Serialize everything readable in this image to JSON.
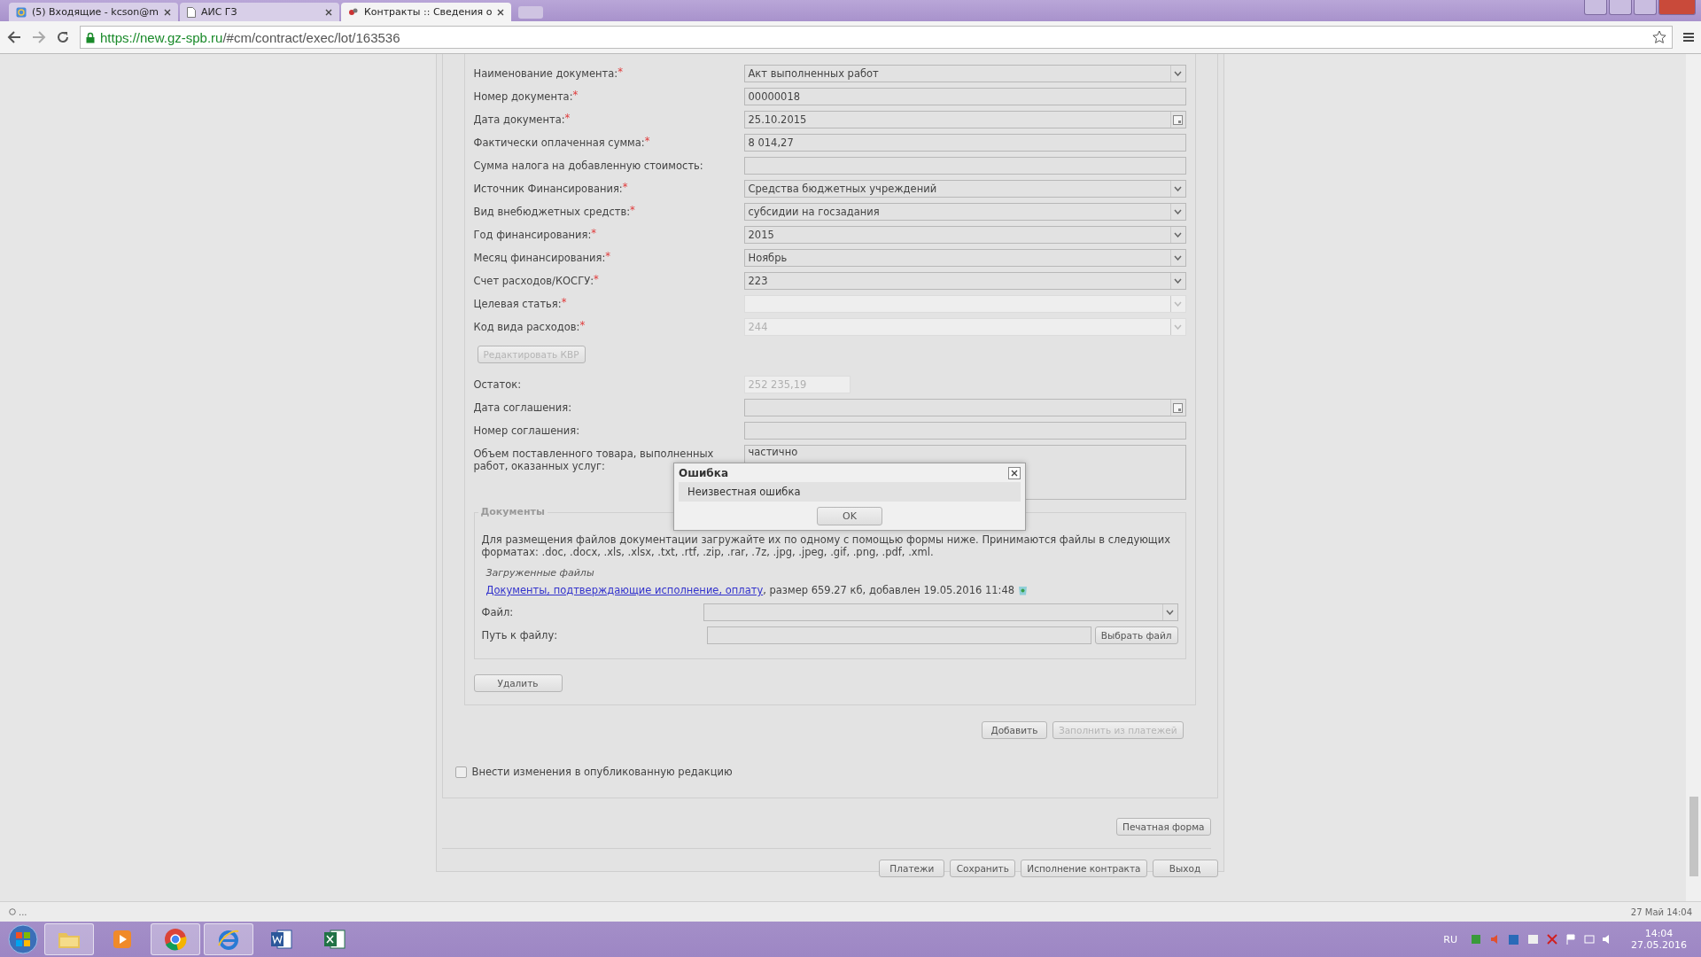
{
  "browser": {
    "tabs": [
      {
        "title": "(5) Входящие - kcson@m",
        "kind": "mail",
        "selected": false
      },
      {
        "title": "АИС ГЗ",
        "kind": "page",
        "selected": false
      },
      {
        "title": "Контракты :: Сведения о",
        "kind": "app",
        "selected": true
      }
    ],
    "url": {
      "host": "https://new.gz-spb.ru",
      "path": "/#cm/contract/exec/lot/163536"
    }
  },
  "form": {
    "fields": [
      {
        "label": "Наименование документа:",
        "required_mark": "*",
        "kind": "select",
        "value": "Акт выполненных работ",
        "disabled": false
      },
      {
        "label": "Номер документа:",
        "required_mark": "*",
        "kind": "text",
        "value": "00000018",
        "disabled": false
      },
      {
        "label": "Дата документа:",
        "required_mark": "*",
        "kind": "date",
        "value": "25.10.2015",
        "disabled": false
      },
      {
        "label": "Фактически оплаченная сумма:",
        "required_mark": "*",
        "kind": "text",
        "value": "8 014,27",
        "disabled": false
      },
      {
        "label": "Сумма налога на добавленную стоимость:",
        "kind": "text",
        "disabled": false
      },
      {
        "label": "Источник Финансирования:",
        "required_mark": "*",
        "kind": "select",
        "value": "Средства бюджетных учреждений",
        "disabled": false
      },
      {
        "label": "Вид внебюджетных средств:",
        "required_mark": "*",
        "kind": "select",
        "value": "субсидии на госзадания",
        "disabled": false
      },
      {
        "label": "Год финансирования:",
        "required_mark": "*",
        "kind": "select",
        "value": "2015",
        "disabled": false
      },
      {
        "label": "Месяц финансирования:",
        "required_mark": "*",
        "kind": "select",
        "value": "Ноябрь",
        "disabled": false
      },
      {
        "label": "Счет расходов/КОСГУ:",
        "required_mark": "*",
        "kind": "select",
        "value": "223",
        "disabled": false
      },
      {
        "label": "Целевая статья:",
        "required_mark": "*",
        "kind": "select",
        "disabled": true
      },
      {
        "label": "Код вида расходов:",
        "required_mark": "*",
        "kind": "select",
        "value": "244",
        "disabled": true
      }
    ],
    "edit_kvr_button": {
      "label": "Редактировать КВР",
      "disabled": true
    },
    "more_fields": [
      {
        "label": "Остаток:",
        "kind": "short",
        "value": "252 235,19",
        "disabled": true
      },
      {
        "label": "Дата соглашения:",
        "kind": "date",
        "disabled": false
      },
      {
        "label": "Номер соглашения:",
        "kind": "text",
        "disabled": false
      },
      {
        "label": "Объем поставленного товара, выполненных работ, оказанных услуг:",
        "kind": "textarea",
        "value": "частично",
        "disabled": false
      }
    ],
    "documents": {
      "legend": "Документы",
      "note": "Для размещения файлов документации загружайте их по одному с помощью формы ниже. Принимаются файлы в следующих форматах: .doc, .docx, .xls, .xlsx, .txt, .rtf, .zip, .rar, .7z, .jpg, .jpeg, .gif, .png, .pdf, .xml.",
      "uploaded_label": "Загруженные файлы",
      "files": [
        {
          "link": "Документы, подтверждающие исполнение, оплату",
          "info": ", размер 659.27 кб, добавлен 19.05.2016 11:48"
        }
      ],
      "file_label": "Файл:",
      "path_label": "Путь к файлу:",
      "browse_button": "Выбрать файл"
    },
    "delete_button": "Удалить",
    "actions": [
      {
        "label": "Добавить",
        "disabled": false
      },
      {
        "label": "Заполнить из платежей",
        "disabled": true
      }
    ],
    "publish_checkbox": {
      "label": "Внести изменения в опубликованную редакцию",
      "checked": false
    },
    "print_button": "Печатная форма",
    "footer_buttons": [
      "Платежи",
      "Сохранить",
      "Исполнение контракта",
      "Выход"
    ]
  },
  "dialog": {
    "title": "Ошибка",
    "message": "Неизвестная ошибка",
    "button": "OK"
  },
  "status_bar": {
    "left": "...",
    "right": "27 Май 14:04"
  },
  "taskbar": {
    "apps": [
      {
        "kind": "folder",
        "open": true
      },
      {
        "kind": "player",
        "open": false
      },
      {
        "kind": "chrome",
        "open": true
      },
      {
        "kind": "ie",
        "open": true
      },
      {
        "kind": "word",
        "open": false
      },
      {
        "kind": "excel",
        "open": false
      }
    ],
    "language": "RU",
    "time": "14:04",
    "date": "27.05.2016"
  }
}
